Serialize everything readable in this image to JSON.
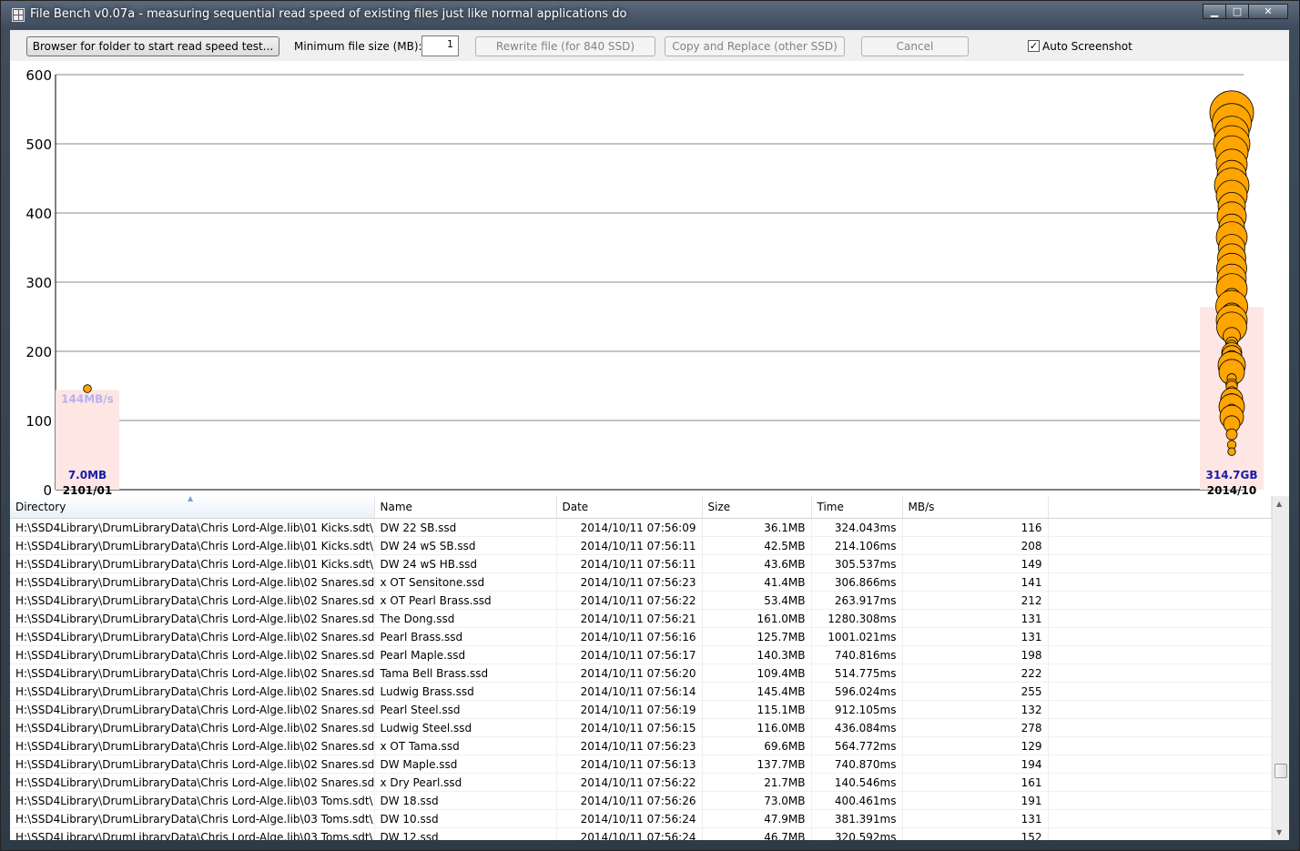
{
  "window": {
    "title": "File Bench v0.07a - measuring sequential read speed of existing files just like normal applications do",
    "minimize_glyph": "▁",
    "maximize_glyph": "□",
    "close_glyph": "✕"
  },
  "toolbar": {
    "browse_label": "Browser for folder to start read speed test...",
    "min_size_label": "Minimum file size (MB):",
    "min_size_value": "1",
    "rewrite_label": "Rewrite file (for 840 SSD)",
    "copy_replace_label": "Copy and Replace (other SSD)",
    "cancel_label": "Cancel",
    "auto_screenshot_label": "Auto Screenshot",
    "auto_screenshot_checked": true,
    "check_glyph": "✓"
  },
  "chart_data": {
    "type": "scatter",
    "ylim": [
      0,
      600
    ],
    "yticks": [
      "0",
      "100",
      "200",
      "300",
      "400",
      "500",
      "600"
    ],
    "grid": true,
    "groups": [
      {
        "date": "2101/01",
        "size": "7.0MB",
        "avg": "144MB/s",
        "points": [
          {
            "mbps": 146,
            "size_mb": 7.0
          }
        ]
      },
      {
        "date": "2014/10",
        "size": "314.7GB",
        "avg": "264",
        "points": [
          {
            "mbps": 545,
            "size_mb": 400
          },
          {
            "mbps": 530,
            "size_mb": 350
          },
          {
            "mbps": 515,
            "size_mb": 300
          },
          {
            "mbps": 500,
            "size_mb": 320
          },
          {
            "mbps": 488,
            "size_mb": 280
          },
          {
            "mbps": 470,
            "size_mb": 260
          },
          {
            "mbps": 455,
            "size_mb": 240
          },
          {
            "mbps": 440,
            "size_mb": 300
          },
          {
            "mbps": 425,
            "size_mb": 260
          },
          {
            "mbps": 410,
            "size_mb": 220
          },
          {
            "mbps": 395,
            "size_mb": 240
          },
          {
            "mbps": 380,
            "size_mb": 200
          },
          {
            "mbps": 365,
            "size_mb": 260
          },
          {
            "mbps": 350,
            "size_mb": 210
          },
          {
            "mbps": 335,
            "size_mb": 230
          },
          {
            "mbps": 320,
            "size_mb": 250
          },
          {
            "mbps": 305,
            "size_mb": 240
          },
          {
            "mbps": 290,
            "size_mb": 260
          },
          {
            "mbps": 278,
            "size_mb": 116
          },
          {
            "mbps": 265,
            "size_mb": 270
          },
          {
            "mbps": 255,
            "size_mb": 145
          },
          {
            "mbps": 245,
            "size_mb": 260
          },
          {
            "mbps": 235,
            "size_mb": 250
          },
          {
            "mbps": 222,
            "size_mb": 109
          },
          {
            "mbps": 212,
            "size_mb": 53
          },
          {
            "mbps": 208,
            "size_mb": 42.5
          },
          {
            "mbps": 198,
            "size_mb": 140
          },
          {
            "mbps": 194,
            "size_mb": 137.7
          },
          {
            "mbps": 191,
            "size_mb": 73
          },
          {
            "mbps": 180,
            "size_mb": 220
          },
          {
            "mbps": 170,
            "size_mb": 200
          },
          {
            "mbps": 161,
            "size_mb": 21.7
          },
          {
            "mbps": 152,
            "size_mb": 46.7
          },
          {
            "mbps": 149,
            "size_mb": 43.6
          },
          {
            "mbps": 141,
            "size_mb": 41.4
          },
          {
            "mbps": 132,
            "size_mb": 115.1
          },
          {
            "mbps": 131,
            "size_mb": 161
          },
          {
            "mbps": 129,
            "size_mb": 69.6
          },
          {
            "mbps": 120,
            "size_mb": 200
          },
          {
            "mbps": 116,
            "size_mb": 36.1
          },
          {
            "mbps": 105,
            "size_mb": 180
          },
          {
            "mbps": 95,
            "size_mb": 100
          },
          {
            "mbps": 80,
            "size_mb": 40
          },
          {
            "mbps": 65,
            "size_mb": 15
          },
          {
            "mbps": 55,
            "size_mb": 5
          }
        ]
      }
    ],
    "colors": {
      "point": "#ffa500",
      "point_outline": "#000000",
      "band": "#fde6e4",
      "size_label": "#1a1aa6",
      "avg_label": "#b9b0f0"
    }
  },
  "table": {
    "columns": [
      "Directory",
      "Name",
      "Date",
      "Size",
      "Time",
      "MB/s"
    ],
    "rows": [
      [
        "H:\\SSD4Library\\DrumLibraryData\\Chris Lord-Alge.lib\\01 Kicks.sdt\\",
        "DW 22 SB.ssd",
        "2014/10/11 07:56:09",
        "36.1MB",
        "324.043ms",
        "116"
      ],
      [
        "H:\\SSD4Library\\DrumLibraryData\\Chris Lord-Alge.lib\\01 Kicks.sdt\\",
        "DW 24 wS SB.ssd",
        "2014/10/11 07:56:11",
        "42.5MB",
        "214.106ms",
        "208"
      ],
      [
        "H:\\SSD4Library\\DrumLibraryData\\Chris Lord-Alge.lib\\01 Kicks.sdt\\",
        "DW 24 wS HB.ssd",
        "2014/10/11 07:56:11",
        "43.6MB",
        "305.537ms",
        "149"
      ],
      [
        "H:\\SSD4Library\\DrumLibraryData\\Chris Lord-Alge.lib\\02 Snares.sdt\\",
        "x OT Sensitone.ssd",
        "2014/10/11 07:56:23",
        "41.4MB",
        "306.866ms",
        "141"
      ],
      [
        "H:\\SSD4Library\\DrumLibraryData\\Chris Lord-Alge.lib\\02 Snares.sdt\\",
        "x OT Pearl Brass.ssd",
        "2014/10/11 07:56:22",
        "53.4MB",
        "263.917ms",
        "212"
      ],
      [
        "H:\\SSD4Library\\DrumLibraryData\\Chris Lord-Alge.lib\\02 Snares.sdt\\",
        "The Dong.ssd",
        "2014/10/11 07:56:21",
        "161.0MB",
        "1280.308ms",
        "131"
      ],
      [
        "H:\\SSD4Library\\DrumLibraryData\\Chris Lord-Alge.lib\\02 Snares.sdt\\",
        "Pearl Brass.ssd",
        "2014/10/11 07:56:16",
        "125.7MB",
        "1001.021ms",
        "131"
      ],
      [
        "H:\\SSD4Library\\DrumLibraryData\\Chris Lord-Alge.lib\\02 Snares.sdt\\",
        "Pearl Maple.ssd",
        "2014/10/11 07:56:17",
        "140.3MB",
        "740.816ms",
        "198"
      ],
      [
        "H:\\SSD4Library\\DrumLibraryData\\Chris Lord-Alge.lib\\02 Snares.sdt\\",
        "Tama Bell Brass.ssd",
        "2014/10/11 07:56:20",
        "109.4MB",
        "514.775ms",
        "222"
      ],
      [
        "H:\\SSD4Library\\DrumLibraryData\\Chris Lord-Alge.lib\\02 Snares.sdt\\",
        "Ludwig Brass.ssd",
        "2014/10/11 07:56:14",
        "145.4MB",
        "596.024ms",
        "255"
      ],
      [
        "H:\\SSD4Library\\DrumLibraryData\\Chris Lord-Alge.lib\\02 Snares.sdt\\",
        "Pearl Steel.ssd",
        "2014/10/11 07:56:19",
        "115.1MB",
        "912.105ms",
        "132"
      ],
      [
        "H:\\SSD4Library\\DrumLibraryData\\Chris Lord-Alge.lib\\02 Snares.sdt\\",
        "Ludwig Steel.ssd",
        "2014/10/11 07:56:15",
        "116.0MB",
        "436.084ms",
        "278"
      ],
      [
        "H:\\SSD4Library\\DrumLibraryData\\Chris Lord-Alge.lib\\02 Snares.sdt\\",
        "x OT Tama.ssd",
        "2014/10/11 07:56:23",
        "69.6MB",
        "564.772ms",
        "129"
      ],
      [
        "H:\\SSD4Library\\DrumLibraryData\\Chris Lord-Alge.lib\\02 Snares.sdt\\",
        "DW Maple.ssd",
        "2014/10/11 07:56:13",
        "137.7MB",
        "740.870ms",
        "194"
      ],
      [
        "H:\\SSD4Library\\DrumLibraryData\\Chris Lord-Alge.lib\\02 Snares.sdt\\",
        "x Dry Pearl.ssd",
        "2014/10/11 07:56:22",
        "21.7MB",
        "140.546ms",
        "161"
      ],
      [
        "H:\\SSD4Library\\DrumLibraryData\\Chris Lord-Alge.lib\\03 Toms.sdt\\",
        "DW 18.ssd",
        "2014/10/11 07:56:26",
        "73.0MB",
        "400.461ms",
        "191"
      ],
      [
        "H:\\SSD4Library\\DrumLibraryData\\Chris Lord-Alge.lib\\03 Toms.sdt\\",
        "DW 10.ssd",
        "2014/10/11 07:56:24",
        "47.9MB",
        "381.391ms",
        "131"
      ],
      [
        "H:\\SSD4Library\\DrumLibraryData\\Chris Lord-Alge.lib\\03 Toms.sdt\\",
        "DW 12.ssd",
        "2014/10/11 07:56:24",
        "46.7MB",
        "320.592ms",
        "152"
      ]
    ]
  }
}
